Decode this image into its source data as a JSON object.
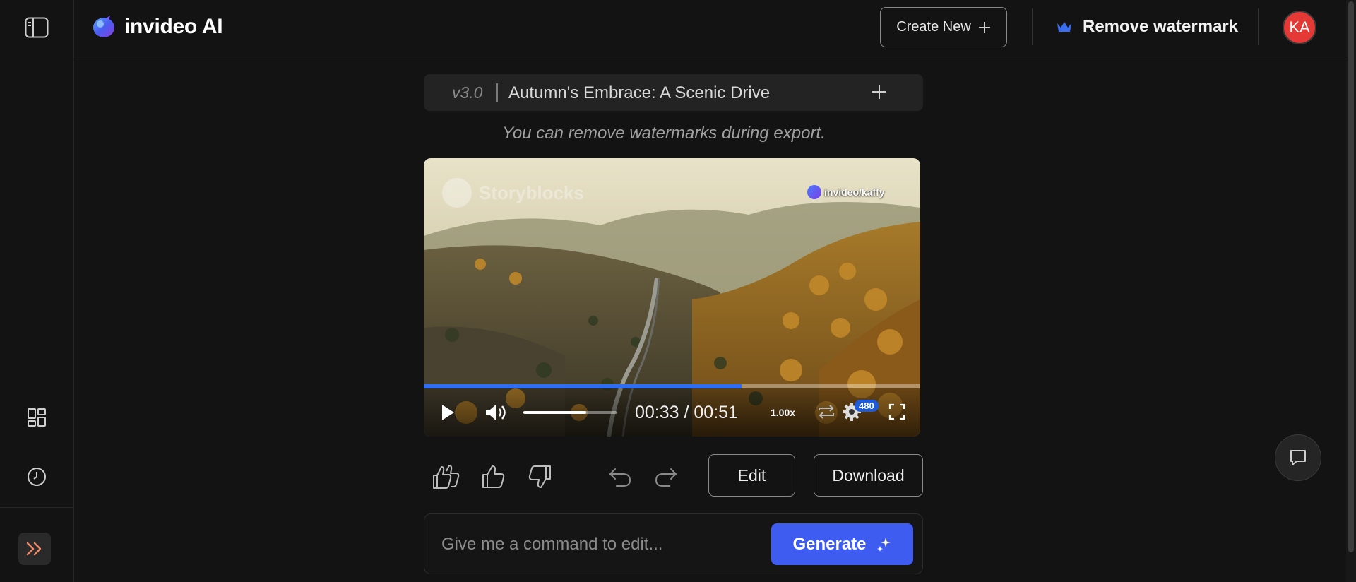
{
  "header": {
    "logo_text": "invideo AI",
    "create_new_label": "Create New",
    "remove_watermark_label": "Remove watermark",
    "avatar_initials": "KA"
  },
  "project": {
    "version": "v3.0",
    "title": "Autumn's Embrace: A Scenic Drive",
    "notice": "You can remove watermarks during export."
  },
  "player": {
    "watermark_left": "Storyblocks",
    "watermark_right": "invideo/kaffy",
    "current_time": "00:33",
    "duration": "00:51",
    "time_display": "00:33 / 00:51",
    "progress": 0.64,
    "volume": 0.67,
    "speed": "1.00x",
    "quality": "480"
  },
  "actions": {
    "edit_label": "Edit",
    "download_label": "Download"
  },
  "command": {
    "placeholder": "Give me a command to edit...",
    "generate_label": "Generate"
  },
  "colors": {
    "accent": "#3f5cf0",
    "progress": "#2f6df5",
    "avatar": "#e53935",
    "expand_icon": "#f08a6a",
    "crown": "#3a6df0"
  },
  "icons": {
    "sidebar_toggle": "sidebar-panel-icon",
    "dashboard": "grid-icon",
    "history": "clock-icon",
    "expand": "double-chevron-right-icon",
    "chat": "chat-bubble-icon"
  }
}
